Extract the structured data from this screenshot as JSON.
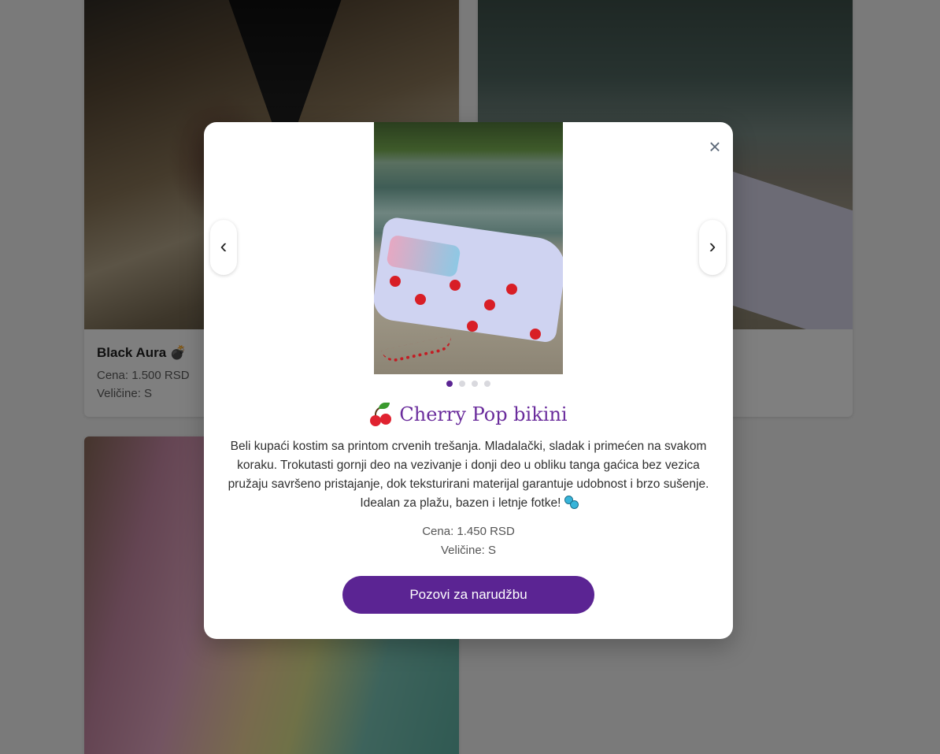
{
  "grid": {
    "cards": [
      {
        "title": "Black Aura",
        "emoji": "💣",
        "price": "Cena: 1.500 RSD",
        "sizes": "Veličine: S"
      }
    ]
  },
  "modal": {
    "title": "Cherry Pop bikini",
    "title_icon": "cherry-icon",
    "description": "Beli kupaći kostim sa printom crvenih trešanja. Mladalački, sladak i primećen na svakom koraku. Trokutasti gornji deo na vezivanje i donji deo u obliku tanga gaćica bez vezica pružaju savršeno pristajanje, dok teksturirani materijal garantuje udobnost i brzo sušenje. Idealan za plažu, bazen i letnje fotke!",
    "description_icon": "sparkles-icon",
    "price": "Cena: 1.450 RSD",
    "sizes": "Veličine: S",
    "order_button": "Pozovi za narudžbu",
    "close_symbol": "×",
    "prev_symbol": "‹",
    "next_symbol": "›",
    "carousel": {
      "total_images": 4,
      "active_index": 0
    }
  },
  "colors": {
    "accent": "#5b2493",
    "title": "#6a2c9c",
    "dot_active": "#5b2593",
    "dot_inactive": "#d9d9de"
  }
}
